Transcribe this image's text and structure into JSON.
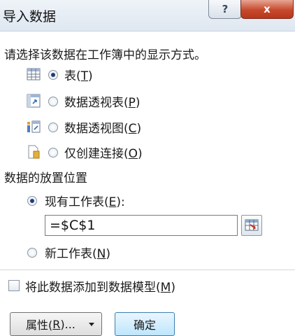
{
  "dialog": {
    "title": "导入数据",
    "help_label": "?",
    "close_label": "x"
  },
  "view_section": {
    "prompt": "请选择该数据在工作簿中的显示方式。",
    "options": [
      {
        "label": "表(",
        "key": "T",
        "tail": ")",
        "selected": true,
        "icon": "table-icon"
      },
      {
        "label": "数据透视表(",
        "key": "P",
        "tail": ")",
        "selected": false,
        "icon": "pivot-table-icon"
      },
      {
        "label": "数据透视图(",
        "key": "C",
        "tail": ")",
        "selected": false,
        "icon": "pivot-chart-icon"
      },
      {
        "label": "仅创建连接(",
        "key": "O",
        "tail": ")",
        "selected": false,
        "icon": "connection-icon"
      }
    ]
  },
  "location_section": {
    "heading": "数据的放置位置",
    "existing_label": "现有工作表(",
    "existing_key": "E",
    "existing_tail": "):",
    "existing_selected": true,
    "reference_value": "=$C$1",
    "new_label": "新工作表(",
    "new_key": "N",
    "new_tail": ")",
    "new_selected": false
  },
  "add_to_model": {
    "label": "将此数据添加到数据模型(",
    "key": "M",
    "tail": ")",
    "checked": false
  },
  "buttons": {
    "properties_label": "属性(",
    "properties_key": "R",
    "properties_tail": ")...",
    "ok_label": "确定"
  }
}
